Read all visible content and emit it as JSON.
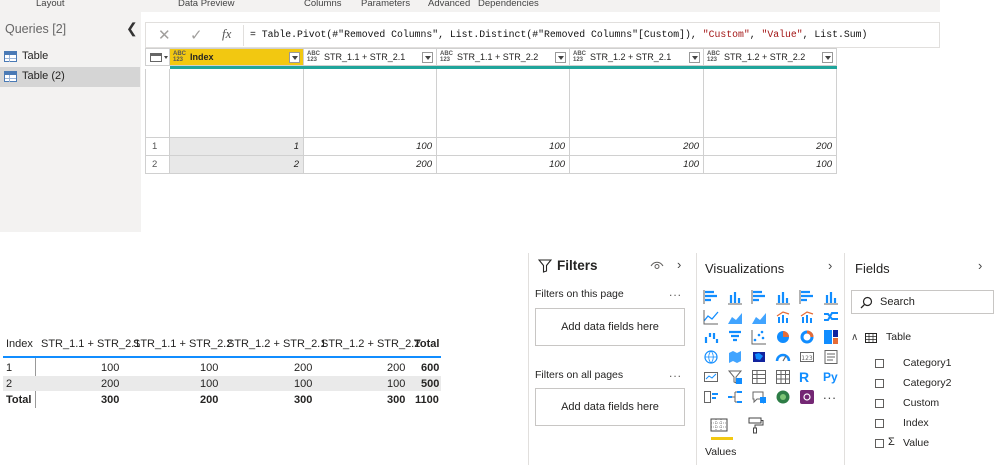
{
  "power_query": {
    "ribbon_tabs": [
      "Layout",
      "Data Preview",
      "Columns",
      "Parameters",
      "Advanced",
      "Dependencies"
    ],
    "queries_title": "Queries [2]",
    "queries": [
      {
        "name": "Table",
        "selected": false
      },
      {
        "name": "Table (2)",
        "selected": true
      }
    ],
    "formula": {
      "icon_cancel": "close-icon",
      "icon_commit": "check-icon",
      "fx_label": "fx",
      "text_part1": "= Table.Pivot(#\"Removed Columns\", List.Distinct(#\"Removed Columns\"[Custom]), ",
      "text_str1": "\"Custom\"",
      "text_part2": ", ",
      "text_str2": "\"Value\"",
      "text_part3": ", List.Sum)"
    },
    "grid": {
      "type_badge_top": "ABC",
      "type_badge_bottom": "123",
      "columns": [
        "Index",
        "STR_1.1 + STR_2.1",
        "STR_1.1 + STR_2.2",
        "STR_1.2 + STR_2.1",
        "STR_1.2 + STR_2.2"
      ],
      "row_numbers": [
        "1",
        "2"
      ],
      "rows": [
        [
          "1",
          "100",
          "100",
          "200",
          "200"
        ],
        [
          "2",
          "200",
          "100",
          "100",
          "100"
        ]
      ]
    }
  },
  "matrix": {
    "headers": [
      "Index",
      "STR_1.1 + STR_2.1",
      "STR_1.1 + STR_2.2",
      "STR_1.2 + STR_2.1",
      "STR_1.2 + STR_2.2",
      "Total"
    ],
    "rows": [
      [
        "1",
        "100",
        "100",
        "200",
        "200",
        "600"
      ],
      [
        "2",
        "200",
        "100",
        "100",
        "100",
        "500"
      ]
    ],
    "total_row": [
      "Total",
      "300",
      "200",
      "300",
      "300",
      "1100"
    ]
  },
  "filters": {
    "title": "Filters",
    "on_this_page": "Filters on this page",
    "on_all_pages": "Filters on all pages",
    "add_fields_1": "Add data fields here",
    "add_fields_2": "Add data fields here",
    "more": "..."
  },
  "visualizations": {
    "title": "Visualizations",
    "icons": [
      "stacked-bar-icon",
      "stacked-column-icon",
      "clustered-bar-icon",
      "clustered-column-icon",
      "100-bar-icon",
      "100-column-icon",
      "line-icon",
      "area-icon",
      "stacked-area-icon",
      "line-column-icon",
      "line-clustered-icon",
      "ribbon-icon",
      "waterfall-icon",
      "funnel-icon",
      "scatter-icon",
      "pie-icon",
      "donut-icon",
      "treemap-icon",
      "map-icon",
      "filled-map-icon",
      "shape-map-icon",
      "gauge-icon",
      "card-icon",
      "multirow-card-icon",
      "kpi-icon",
      "slicer-icon",
      "table-icon",
      "matrix-icon",
      "r-visual-icon",
      "python-visual-icon",
      "key-influencers-icon",
      "decomposition-tree-icon",
      "qa-icon",
      "arcgis-icon",
      "power-apps-icon",
      "more-visuals-icon"
    ],
    "r_label": "R",
    "py_label": "Py",
    "more_label": "...",
    "values_label": "Values"
  },
  "fields": {
    "title": "Fields",
    "search_placeholder": "Search",
    "table_name": "Table",
    "items": [
      "Category1",
      "Category2",
      "Custom",
      "Index",
      "Value"
    ],
    "sigma": "Σ"
  },
  "colors": {
    "accent_yellow": "#f2c811",
    "accent_teal": "#20a59b",
    "matrix_line": "#118dff",
    "viz_blue": "#118dff"
  }
}
